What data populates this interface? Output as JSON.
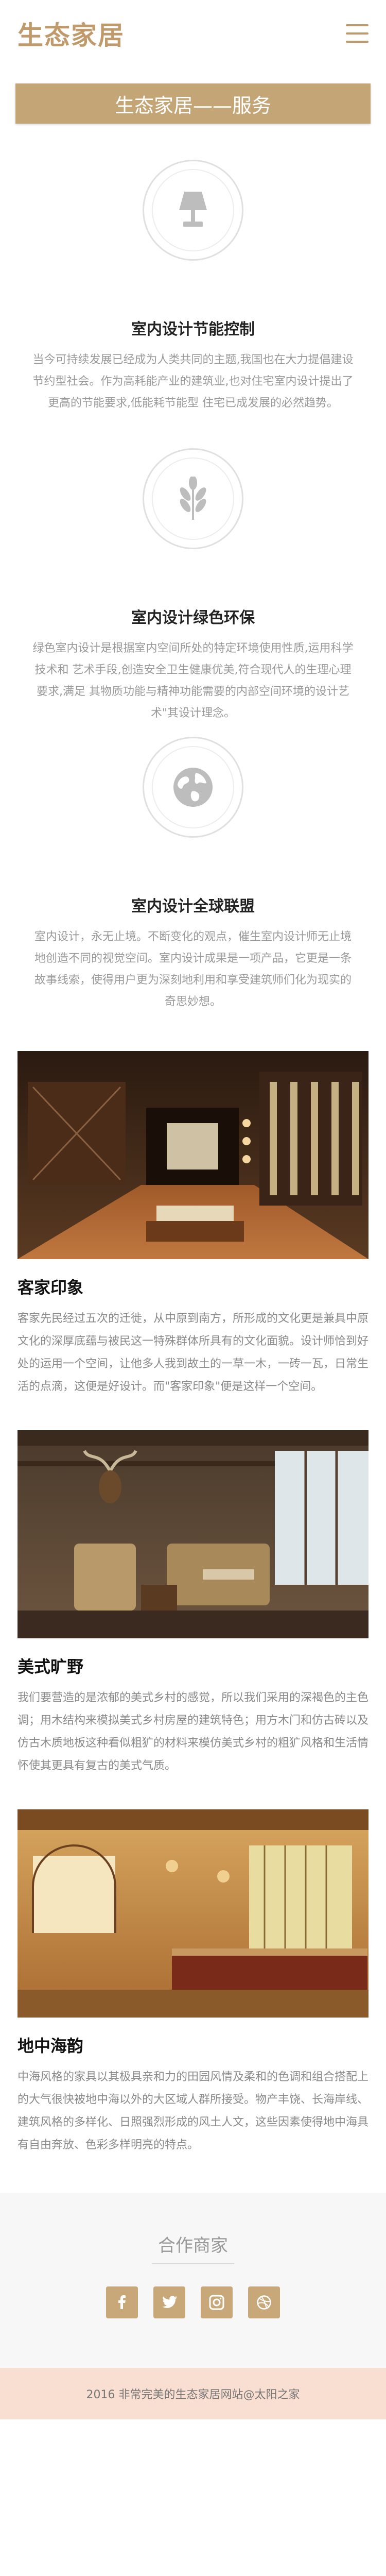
{
  "header": {
    "logo": "生态家居",
    "menu_icon": "hamburger-menu-icon"
  },
  "banner": {
    "title": "生态家居——服务"
  },
  "services": [
    {
      "icon": "lamp-icon",
      "title": "室内设计节能控制",
      "text": "当今可持续发展已经成为人类共同的主题,我国也在大力提倡建设节约型社会。作为高耗能产业的建筑业,也对住宅室内设计提出了更高的节能要求,低能耗节能型 住宅已成发展的必然趋势。"
    },
    {
      "icon": "leaf-icon",
      "title": "室内设计绿色环保",
      "text": "绿色室内设计是根据室内空间所处的特定环境使用性质,运用科学技术和 艺术手段,创造安全卫生健康优美,符合现代人的生理心理要求,满足 其物质功能与精神功能需要的内部空间环境的设计艺术\"其设计理念。"
    },
    {
      "icon": "globe-icon",
      "title": "室内设计全球联盟",
      "text": "室内设计，永无止境。不断变化的观点，催生室内设计师无止境地创造不同的视觉空间。室内设计成果是一项产品，它更是一条故事线索，使得用户更为深刻地利用和享受建筑师们化为现实的奇思妙想。"
    }
  ],
  "showcase": [
    {
      "title": "客家印象",
      "text": "客家先民经过五次的迁徙，从中原到南方，所形成的文化更是兼具中原文化的深厚底蕴与被民这一特殊群体所具有的文化面貌。设计师恰到好处的运用一个空间，让他多人我到故土的一草一木，一砖一瓦，日常生活的点滴，这便是好设计。而\"客家印象\"便是这样一个空间。"
    },
    {
      "title": "美式旷野",
      "text": "我们要营造的是浓郁的美式乡村的感觉，所以我们采用的深褐色的主色调；用木结构来模拟美式乡村房屋的建筑特色；用方木门和仿古砖以及仿古木质地板这种看似粗犷的材料来模仿美式乡村的粗犷风格和生活情怀使其更具有复古的美式气质。"
    },
    {
      "title": "地中海韵",
      "text": "中海风格的家具以其极具亲和力的田园风情及柔和的色调和组合搭配上的大气很快被地中海以外的大区域人群所接受。物产丰饶、长海岸线、建筑风格的多样化、日照强烈形成的风土人文，这些因素使得地中海具有自由奔放、色彩多样明亮的特点。"
    }
  ],
  "partners": {
    "title": "合作商家",
    "icons": [
      "facebook-icon",
      "twitter-icon",
      "instagram-icon",
      "dribbble-icon"
    ]
  },
  "footer": {
    "text": "2016 非常完美的生态家居网站@太阳之家"
  },
  "colors": {
    "accent": "#c4a676",
    "footer_bg": "#f8dfd1",
    "partners_bg": "#f7f7f7"
  }
}
